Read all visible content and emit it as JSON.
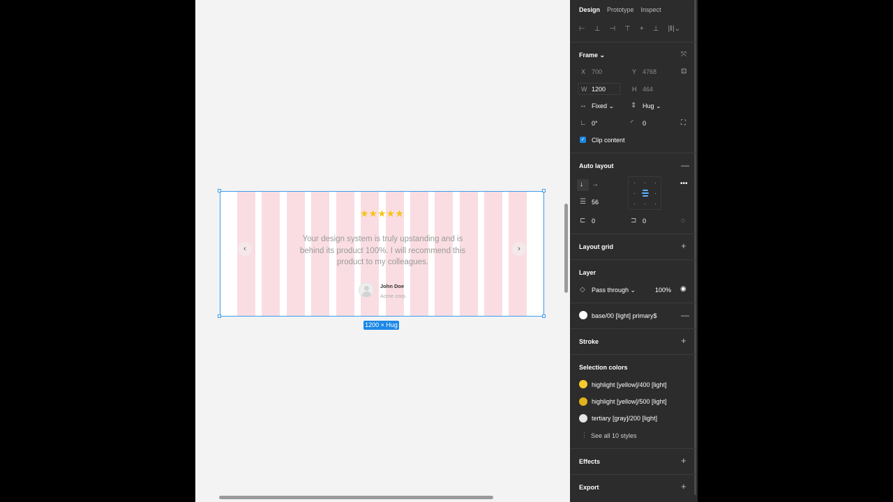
{
  "colors": {
    "selection_blue": "#3d9be9",
    "grid_pink": "#fadde2",
    "star_yellow": "#f5c518",
    "panel_bg": "#2c2c2c"
  },
  "canvas": {
    "frame": {
      "rating": "★★★★★",
      "quote": "Your design system is truly upstanding and is behind its product 100%. I will recommend this product to my colleagues.",
      "author_name": "John Doe",
      "author_company": "Acme corp.",
      "prev_arrow": "‹",
      "next_arrow": "›"
    },
    "size_tag": "1200 × Hug"
  },
  "panel": {
    "tabs": [
      "Design",
      "Prototype",
      "Inspect"
    ],
    "align_icons": [
      "⊢",
      "⊥",
      "⊣",
      "⊤",
      "+",
      "⊥",
      "|‖|⌄"
    ],
    "frame": {
      "title": "Frame ⌄",
      "x_label": "X",
      "x_value": "700",
      "y_label": "Y",
      "y_value": "4768",
      "w_label": "W",
      "w_value": "1200",
      "h_label": "H",
      "h_value": "464",
      "width_mode": "Fixed ⌄",
      "height_mode": "Hug ⌄",
      "rotation": "0°",
      "radius": "0",
      "clip_content": "Clip content"
    },
    "auto_layout": {
      "title": "Auto layout",
      "spacing": "56",
      "padding_h": "0",
      "padding_v": "0"
    },
    "layout_grid": {
      "title": "Layout grid"
    },
    "layer": {
      "title": "Layer",
      "blend": "Pass through ⌄",
      "opacity": "100%"
    },
    "fill": {
      "style": "base/00 [light] primary$"
    },
    "stroke": {
      "title": "Stroke"
    },
    "selection_colors": {
      "title": "Selection colors",
      "items": [
        {
          "label": "highlight [yellow]/400 [light]",
          "color": "#f7cb2d"
        },
        {
          "label": "highlight [yellow]/500 [light]",
          "color": "#e2b21c"
        },
        {
          "label": "tertiary [gray]/200 [light]",
          "color": "#e6e6e6"
        }
      ],
      "see_all": "See all 10 styles"
    },
    "effects": {
      "title": "Effects"
    },
    "export": {
      "title": "Export"
    }
  }
}
